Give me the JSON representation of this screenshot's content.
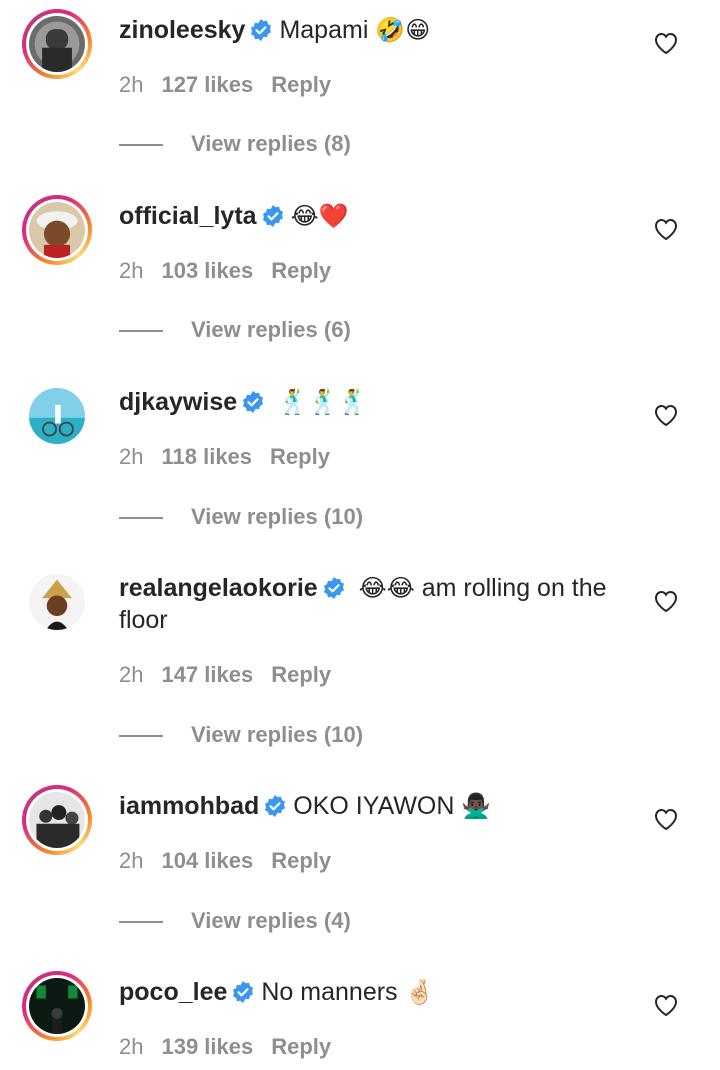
{
  "comments": [
    {
      "username": "zinoleesky",
      "text": "Mapami",
      "emoji": "🤣😁",
      "time": "2h",
      "likes": "127 likes",
      "reply": "Reply",
      "view_replies": "View replies (8)"
    },
    {
      "username": "official_lyta",
      "text": "",
      "emoji": "😂❤️",
      "time": "2h",
      "likes": "103 likes",
      "reply": "Reply",
      "view_replies": "View replies (6)"
    },
    {
      "username": "djkaywise",
      "text": "",
      "emoji": "🕺🕺🕺",
      "time": "2h",
      "likes": "118 likes",
      "reply": "Reply",
      "view_replies": "View replies (10)"
    },
    {
      "username": "realangelaokorie",
      "text": "am rolling on the floor",
      "emoji": "😂😂",
      "time": "2h",
      "likes": "147 likes",
      "reply": "Reply",
      "view_replies": "View replies (10)"
    },
    {
      "username": "iammohbad",
      "text": "OKO IYAWON",
      "emoji": "🙅🏿‍♂️",
      "time": "2h",
      "likes": "104 likes",
      "reply": "Reply",
      "view_replies": "View replies (4)"
    },
    {
      "username": "poco_lee",
      "text": "No manners",
      "emoji": "🤞🏻",
      "time": "2h",
      "likes": "139 likes",
      "reply": "Reply"
    }
  ],
  "colors": {
    "verified": "#3897f0",
    "secondary_text": "#8e8e8e",
    "primary_text": "#262626"
  },
  "icons": {
    "verified": "verified-badge-icon",
    "like": "heart-outline-icon"
  }
}
